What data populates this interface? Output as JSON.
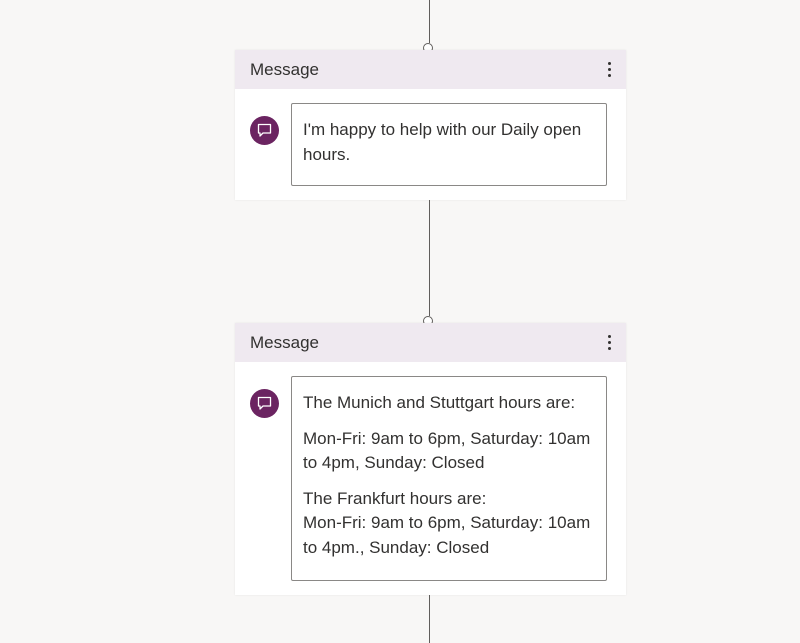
{
  "nodes": [
    {
      "title": "Message",
      "paragraphs": [
        "I'm happy to help with our Daily open hours."
      ]
    },
    {
      "title": "Message",
      "paragraphs": [
        "The Munich and Stuttgart hours are:",
        "Mon-Fri: 9am to 6pm, Saturday: 10am to 4pm, Sunday: Closed",
        "The Frankfurt hours are:\nMon-Fri: 9am to 6pm, Saturday: 10am to 4pm., Sunday: Closed"
      ]
    }
  ],
  "colors": {
    "canvas": "#f8f7f6",
    "header": "#efe9f0",
    "avatar": "#6b2461",
    "connector": "#605e5c"
  },
  "icons": {
    "avatar": "chat-bubble-icon",
    "menu": "more-vertical-icon"
  }
}
